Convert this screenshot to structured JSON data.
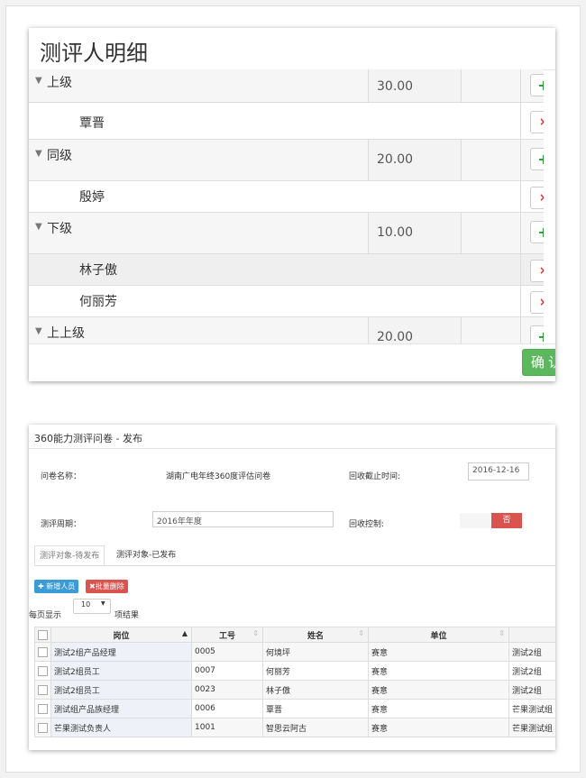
{
  "dialog": {
    "title": "测评人明细",
    "rows": [
      {
        "type": "group",
        "label": "上级",
        "score": "30.00",
        "action": "+"
      },
      {
        "type": "person",
        "label": "覃晋",
        "action": "×"
      },
      {
        "type": "group",
        "label": "同级",
        "score": "20.00",
        "action": "+"
      },
      {
        "type": "person",
        "label": "殷婷",
        "action": "×"
      },
      {
        "type": "group",
        "label": "下级",
        "score": "10.00",
        "action": "+"
      },
      {
        "type": "person",
        "label": "林子傲",
        "action": "×"
      },
      {
        "type": "person",
        "label": "何丽芳",
        "action": "×"
      },
      {
        "type": "group",
        "label": "上上级",
        "score": "20.00",
        "action": "+"
      }
    ],
    "confirm_label": "确认"
  },
  "publish": {
    "title": "360能力测评问卷 - 发布",
    "questionnaire_label": "问卷名称：",
    "questionnaire_value": "湖南广电年终360度评估问卷",
    "deadline_label": "回收截止时间:",
    "deadline_value": "2016-12-16",
    "period_label": "测评周期：",
    "period_value": "2016年年度",
    "control_label": "回收控制:",
    "control_value": "否",
    "tabs": [
      "测评对象-待发布",
      "测评对象-已发布"
    ],
    "add_button": "新增人员",
    "delete_button": "批量删除",
    "page_size_prefix": "每页显示",
    "page_size": "10",
    "page_size_suffix": "项结果",
    "columns": [
      "岗位",
      "工号",
      "姓名",
      "单位"
    ],
    "rows": [
      {
        "position": "测试2组产品经理",
        "id": "0005",
        "name": "何境坪",
        "unit": "赛意",
        "dept": "测试2组"
      },
      {
        "position": "测试2组员工",
        "id": "0007",
        "name": "何丽芳",
        "unit": "赛意",
        "dept": "测试2组"
      },
      {
        "position": "测试2组员工",
        "id": "0023",
        "name": "林子傲",
        "unit": "赛意",
        "dept": "测试2组"
      },
      {
        "position": "测试组产品族经理",
        "id": "0006",
        "name": "覃晋",
        "unit": "赛意",
        "dept": "芒果测试组"
      },
      {
        "position": "芒果测试负责人",
        "id": "1001",
        "name": "智思云阿古",
        "unit": "赛意",
        "dept": "芒果测试组"
      }
    ]
  },
  "colors": {
    "accent_green": "#5cb85c",
    "danger_red": "#d9534f",
    "primary_blue": "#3a9bd6"
  }
}
